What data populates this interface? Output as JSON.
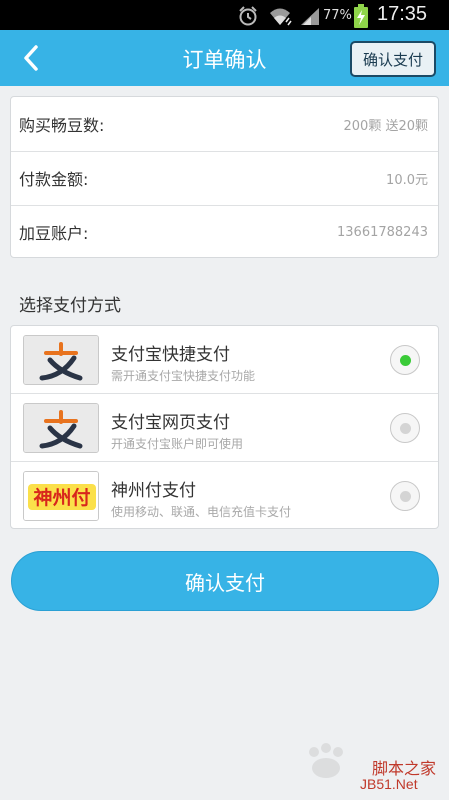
{
  "status_bar": {
    "battery_percent": "77%",
    "time": "17:35",
    "icons": [
      "alarm-icon",
      "wifi-icon",
      "signal-icon",
      "battery-icon"
    ]
  },
  "nav": {
    "back_icon": "back-chevron-icon",
    "title": "订单确认",
    "confirm_label": "确认支付"
  },
  "order": {
    "rows": [
      {
        "label": "购买畅豆数:",
        "value": "200颗 送20颗"
      },
      {
        "label": "付款金额:",
        "value": "10.0元"
      },
      {
        "label": "加豆账户:",
        "value": "13661788243"
      }
    ]
  },
  "payment": {
    "section_title": "选择支付方式",
    "methods": [
      {
        "name": "支付宝快捷支付",
        "desc": "需开通支付宝快捷支付功能",
        "logo": "alipay-logo-icon",
        "selected": true
      },
      {
        "name": "支付宝网页支付",
        "desc": "开通支付宝账户即可使用",
        "logo": "alipay-logo-icon",
        "selected": false
      },
      {
        "name": "神州付支付",
        "desc": "使用移动、联通、电信充值卡支付",
        "logo": "shenzhoufu-logo-icon",
        "logo_text": "神州付",
        "selected": false
      }
    ]
  },
  "main_button": {
    "label": "确认支付"
  },
  "watermark": {
    "site": "脚本之家",
    "url": "JB51.Net"
  },
  "colors": {
    "accent": "#37b3e6",
    "selected": "#3acb38",
    "alipay_orange": "#e8731e",
    "alipay_navy": "#2a3446",
    "shenzhou_red": "#d8261c"
  }
}
